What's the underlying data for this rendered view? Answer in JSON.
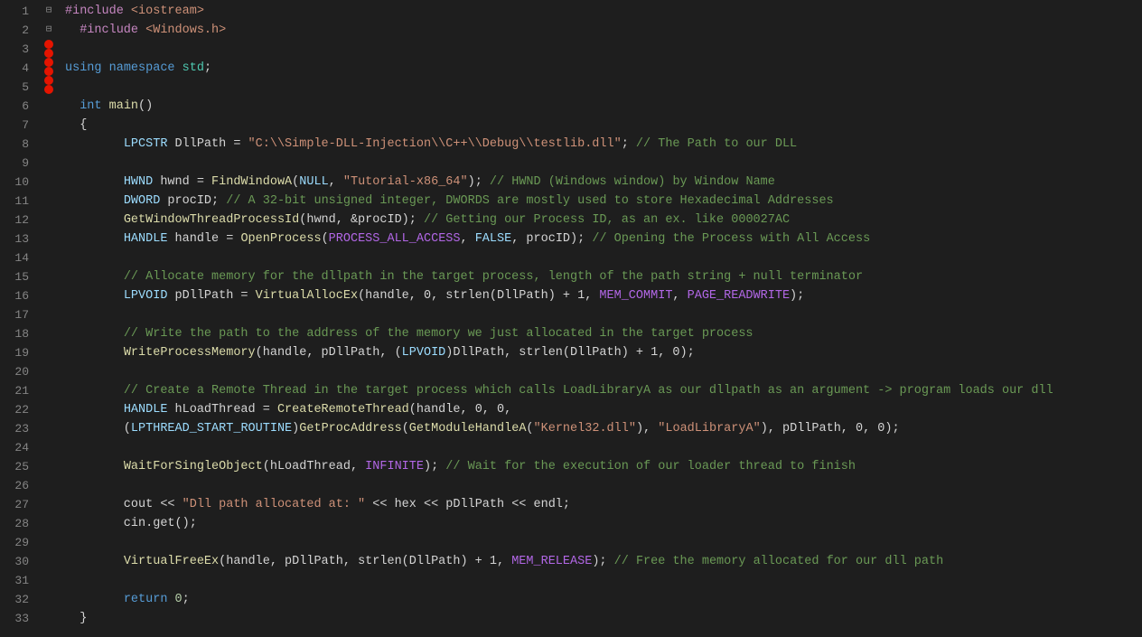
{
  "editor": {
    "background": "#1e1e1e",
    "lines": [
      {
        "num": 1,
        "fold": "⊟",
        "indent": 0,
        "tokens": [
          {
            "t": "pp",
            "v": "#include"
          },
          {
            "t": "plain",
            "v": " "
          },
          {
            "t": "inc",
            "v": "<iostream>"
          }
        ]
      },
      {
        "num": 2,
        "fold": "",
        "indent": 0,
        "tokens": [
          {
            "t": "pp",
            "v": "  #include"
          },
          {
            "t": "plain",
            "v": " "
          },
          {
            "t": "inc",
            "v": "<Windows.h>"
          }
        ]
      },
      {
        "num": 3,
        "fold": "",
        "indent": 0,
        "tokens": []
      },
      {
        "num": 4,
        "fold": "",
        "indent": 1,
        "tokens": [
          {
            "t": "kw",
            "v": "using"
          },
          {
            "t": "plain",
            "v": " "
          },
          {
            "t": "kw",
            "v": "namespace"
          },
          {
            "t": "plain",
            "v": " "
          },
          {
            "t": "ns",
            "v": "std"
          },
          {
            "t": "plain",
            "v": ";"
          }
        ]
      },
      {
        "num": 5,
        "fold": "",
        "indent": 0,
        "tokens": []
      },
      {
        "num": 6,
        "fold": "⊟",
        "indent": 0,
        "tokens": [
          {
            "t": "plain",
            "v": "  "
          },
          {
            "t": "kw",
            "v": "int"
          },
          {
            "t": "plain",
            "v": " "
          },
          {
            "t": "fn",
            "v": "main"
          },
          {
            "t": "plain",
            "v": "()"
          }
        ]
      },
      {
        "num": 7,
        "fold": "",
        "indent": 0,
        "tokens": [
          {
            "t": "plain",
            "v": "  {"
          }
        ]
      },
      {
        "num": 8,
        "fold": "",
        "indent": 0,
        "bp": true,
        "tokens": [
          {
            "t": "plain",
            "v": "        "
          },
          {
            "t": "macro",
            "v": "LPCSTR"
          },
          {
            "t": "plain",
            "v": " DllPath = "
          },
          {
            "t": "str",
            "v": "\"C:\\\\Simple-DLL-Injection\\\\C++\\\\Debug\\\\testlib.dll\""
          },
          {
            "t": "plain",
            "v": "; "
          },
          {
            "t": "cmt",
            "v": "// The Path to our DLL"
          }
        ]
      },
      {
        "num": 9,
        "fold": "",
        "indent": 0,
        "tokens": []
      },
      {
        "num": 10,
        "fold": "",
        "indent": 0,
        "bp": true,
        "tokens": [
          {
            "t": "plain",
            "v": "        "
          },
          {
            "t": "macro",
            "v": "HWND"
          },
          {
            "t": "plain",
            "v": " hwnd = "
          },
          {
            "t": "fn",
            "v": "FindWindowA"
          },
          {
            "t": "plain",
            "v": "("
          },
          {
            "t": "macro",
            "v": "NULL"
          },
          {
            "t": "plain",
            "v": ", "
          },
          {
            "t": "str",
            "v": "\"Tutorial-x86_64\""
          },
          {
            "t": "plain",
            "v": "); "
          },
          {
            "t": "cmt",
            "v": "// HWND (Windows window) by Window Name"
          }
        ]
      },
      {
        "num": 11,
        "fold": "",
        "indent": 0,
        "tokens": [
          {
            "t": "plain",
            "v": "        "
          },
          {
            "t": "macro",
            "v": "DWORD"
          },
          {
            "t": "plain",
            "v": " procID; "
          },
          {
            "t": "cmt",
            "v": "// A 32-bit unsigned integer, DWORDS are mostly used to store Hexadecimal Addresses"
          }
        ]
      },
      {
        "num": 12,
        "fold": "",
        "indent": 0,
        "tokens": [
          {
            "t": "plain",
            "v": "        "
          },
          {
            "t": "fn",
            "v": "GetWindowThreadProcessId"
          },
          {
            "t": "plain",
            "v": "(hwnd, &procID); "
          },
          {
            "t": "cmt",
            "v": "// Getting our Process ID, as an ex. like 000027AC"
          }
        ]
      },
      {
        "num": 13,
        "fold": "",
        "indent": 0,
        "tokens": [
          {
            "t": "plain",
            "v": "        "
          },
          {
            "t": "macro",
            "v": "HANDLE"
          },
          {
            "t": "plain",
            "v": " handle = "
          },
          {
            "t": "fn",
            "v": "OpenProcess"
          },
          {
            "t": "plain",
            "v": "("
          },
          {
            "t": "macro-const",
            "v": "PROCESS_ALL_ACCESS"
          },
          {
            "t": "plain",
            "v": ", "
          },
          {
            "t": "macro",
            "v": "FALSE"
          },
          {
            "t": "plain",
            "v": ", procID); "
          },
          {
            "t": "cmt",
            "v": "// Opening the Process with All Access"
          }
        ]
      },
      {
        "num": 14,
        "fold": "",
        "indent": 0,
        "tokens": []
      },
      {
        "num": 15,
        "fold": "",
        "indent": 0,
        "tokens": [
          {
            "t": "plain",
            "v": "        "
          },
          {
            "t": "cmt",
            "v": "// Allocate memory for the dllpath in the target process, length of the path string + null terminator"
          }
        ]
      },
      {
        "num": 16,
        "fold": "",
        "indent": 0,
        "tokens": [
          {
            "t": "plain",
            "v": "        "
          },
          {
            "t": "macro",
            "v": "LPVOID"
          },
          {
            "t": "plain",
            "v": " pDllPath = "
          },
          {
            "t": "fn",
            "v": "VirtualAllocEx"
          },
          {
            "t": "plain",
            "v": "(handle, 0, strlen(DllPath) + 1, "
          },
          {
            "t": "macro-const",
            "v": "MEM_COMMIT"
          },
          {
            "t": "plain",
            "v": ", "
          },
          {
            "t": "macro-const",
            "v": "PAGE_READWRITE"
          },
          {
            "t": "plain",
            "v": ");"
          }
        ]
      },
      {
        "num": 17,
        "fold": "",
        "indent": 0,
        "tokens": []
      },
      {
        "num": 18,
        "fold": "",
        "indent": 0,
        "bp": true,
        "tokens": [
          {
            "t": "plain",
            "v": "        "
          },
          {
            "t": "cmt",
            "v": "// Write the path to the address of the memory we just allocated in the target process"
          }
        ]
      },
      {
        "num": 19,
        "fold": "",
        "indent": 0,
        "tokens": [
          {
            "t": "plain",
            "v": "        "
          },
          {
            "t": "fn",
            "v": "WriteProcessMemory"
          },
          {
            "t": "plain",
            "v": "(handle, pDllPath, ("
          },
          {
            "t": "macro",
            "v": "LPVOID"
          },
          {
            "t": "plain",
            "v": ")DllPath, strlen(DllPath) + 1, 0);"
          }
        ]
      },
      {
        "num": 20,
        "fold": "",
        "indent": 0,
        "tokens": []
      },
      {
        "num": 21,
        "fold": "",
        "indent": 0,
        "tokens": [
          {
            "t": "plain",
            "v": "        "
          },
          {
            "t": "cmt",
            "v": "// Create a Remote Thread in the target process which calls LoadLibraryA as our dllpath as an argument -> program loads our dll"
          }
        ]
      },
      {
        "num": 22,
        "fold": "",
        "indent": 0,
        "bp": true,
        "tokens": [
          {
            "t": "plain",
            "v": "        "
          },
          {
            "t": "macro",
            "v": "HANDLE"
          },
          {
            "t": "plain",
            "v": " hLoadThread = "
          },
          {
            "t": "fn",
            "v": "CreateRemoteThread"
          },
          {
            "t": "plain",
            "v": "(handle, 0, 0,"
          }
        ]
      },
      {
        "num": 23,
        "fold": "",
        "indent": 0,
        "tokens": [
          {
            "t": "plain",
            "v": "        ("
          },
          {
            "t": "macro",
            "v": "LPTHREAD_START_ROUTINE"
          },
          {
            "t": "plain",
            "v": ")"
          },
          {
            "t": "fn",
            "v": "GetProcAddress"
          },
          {
            "t": "plain",
            "v": "("
          },
          {
            "t": "fn",
            "v": "GetModuleHandleA"
          },
          {
            "t": "plain",
            "v": "("
          },
          {
            "t": "str",
            "v": "\"Kernel32.dll\""
          },
          {
            "t": "plain",
            "v": "), "
          },
          {
            "t": "str",
            "v": "\"LoadLibraryA\""
          },
          {
            "t": "plain",
            "v": "), pDllPath, 0, 0);"
          }
        ]
      },
      {
        "num": 24,
        "fold": "",
        "indent": 0,
        "tokens": []
      },
      {
        "num": 25,
        "fold": "",
        "indent": 0,
        "bp": true,
        "tokens": [
          {
            "t": "plain",
            "v": "        "
          },
          {
            "t": "fn",
            "v": "WaitForSingleObject"
          },
          {
            "t": "plain",
            "v": "(hLoadThread, "
          },
          {
            "t": "macro-const",
            "v": "INFINITE"
          },
          {
            "t": "plain",
            "v": "); "
          },
          {
            "t": "cmt",
            "v": "// Wait for the execution of our loader thread to finish"
          }
        ]
      },
      {
        "num": 26,
        "fold": "",
        "indent": 0,
        "tokens": []
      },
      {
        "num": 27,
        "fold": "",
        "indent": 0,
        "tokens": [
          {
            "t": "plain",
            "v": "        cout << "
          },
          {
            "t": "str",
            "v": "\"Dll path allocated at: \""
          },
          {
            "t": "plain",
            "v": " << hex << pDllPath << endl;"
          }
        ]
      },
      {
        "num": 28,
        "fold": "",
        "indent": 0,
        "tokens": [
          {
            "t": "plain",
            "v": "        cin.get();"
          }
        ]
      },
      {
        "num": 29,
        "fold": "",
        "indent": 0,
        "tokens": []
      },
      {
        "num": 30,
        "fold": "",
        "indent": 0,
        "bp": true,
        "tokens": [
          {
            "t": "plain",
            "v": "        "
          },
          {
            "t": "fn",
            "v": "VirtualFreeEx"
          },
          {
            "t": "plain",
            "v": "(handle, pDllPath, strlen(DllPath) + 1, "
          },
          {
            "t": "macro-const",
            "v": "MEM_RELEASE"
          },
          {
            "t": "plain",
            "v": "); "
          },
          {
            "t": "cmt",
            "v": "// Free the memory allocated for our dll path"
          }
        ]
      },
      {
        "num": 31,
        "fold": "",
        "indent": 0,
        "tokens": []
      },
      {
        "num": 32,
        "fold": "",
        "indent": 0,
        "tokens": [
          {
            "t": "plain",
            "v": "        "
          },
          {
            "t": "kw",
            "v": "return"
          },
          {
            "t": "plain",
            "v": " "
          },
          {
            "t": "num",
            "v": "0"
          },
          {
            "t": "plain",
            "v": ";"
          }
        ]
      },
      {
        "num": 33,
        "fold": "",
        "indent": 0,
        "tokens": [
          {
            "t": "plain",
            "v": "  }"
          }
        ]
      }
    ]
  }
}
